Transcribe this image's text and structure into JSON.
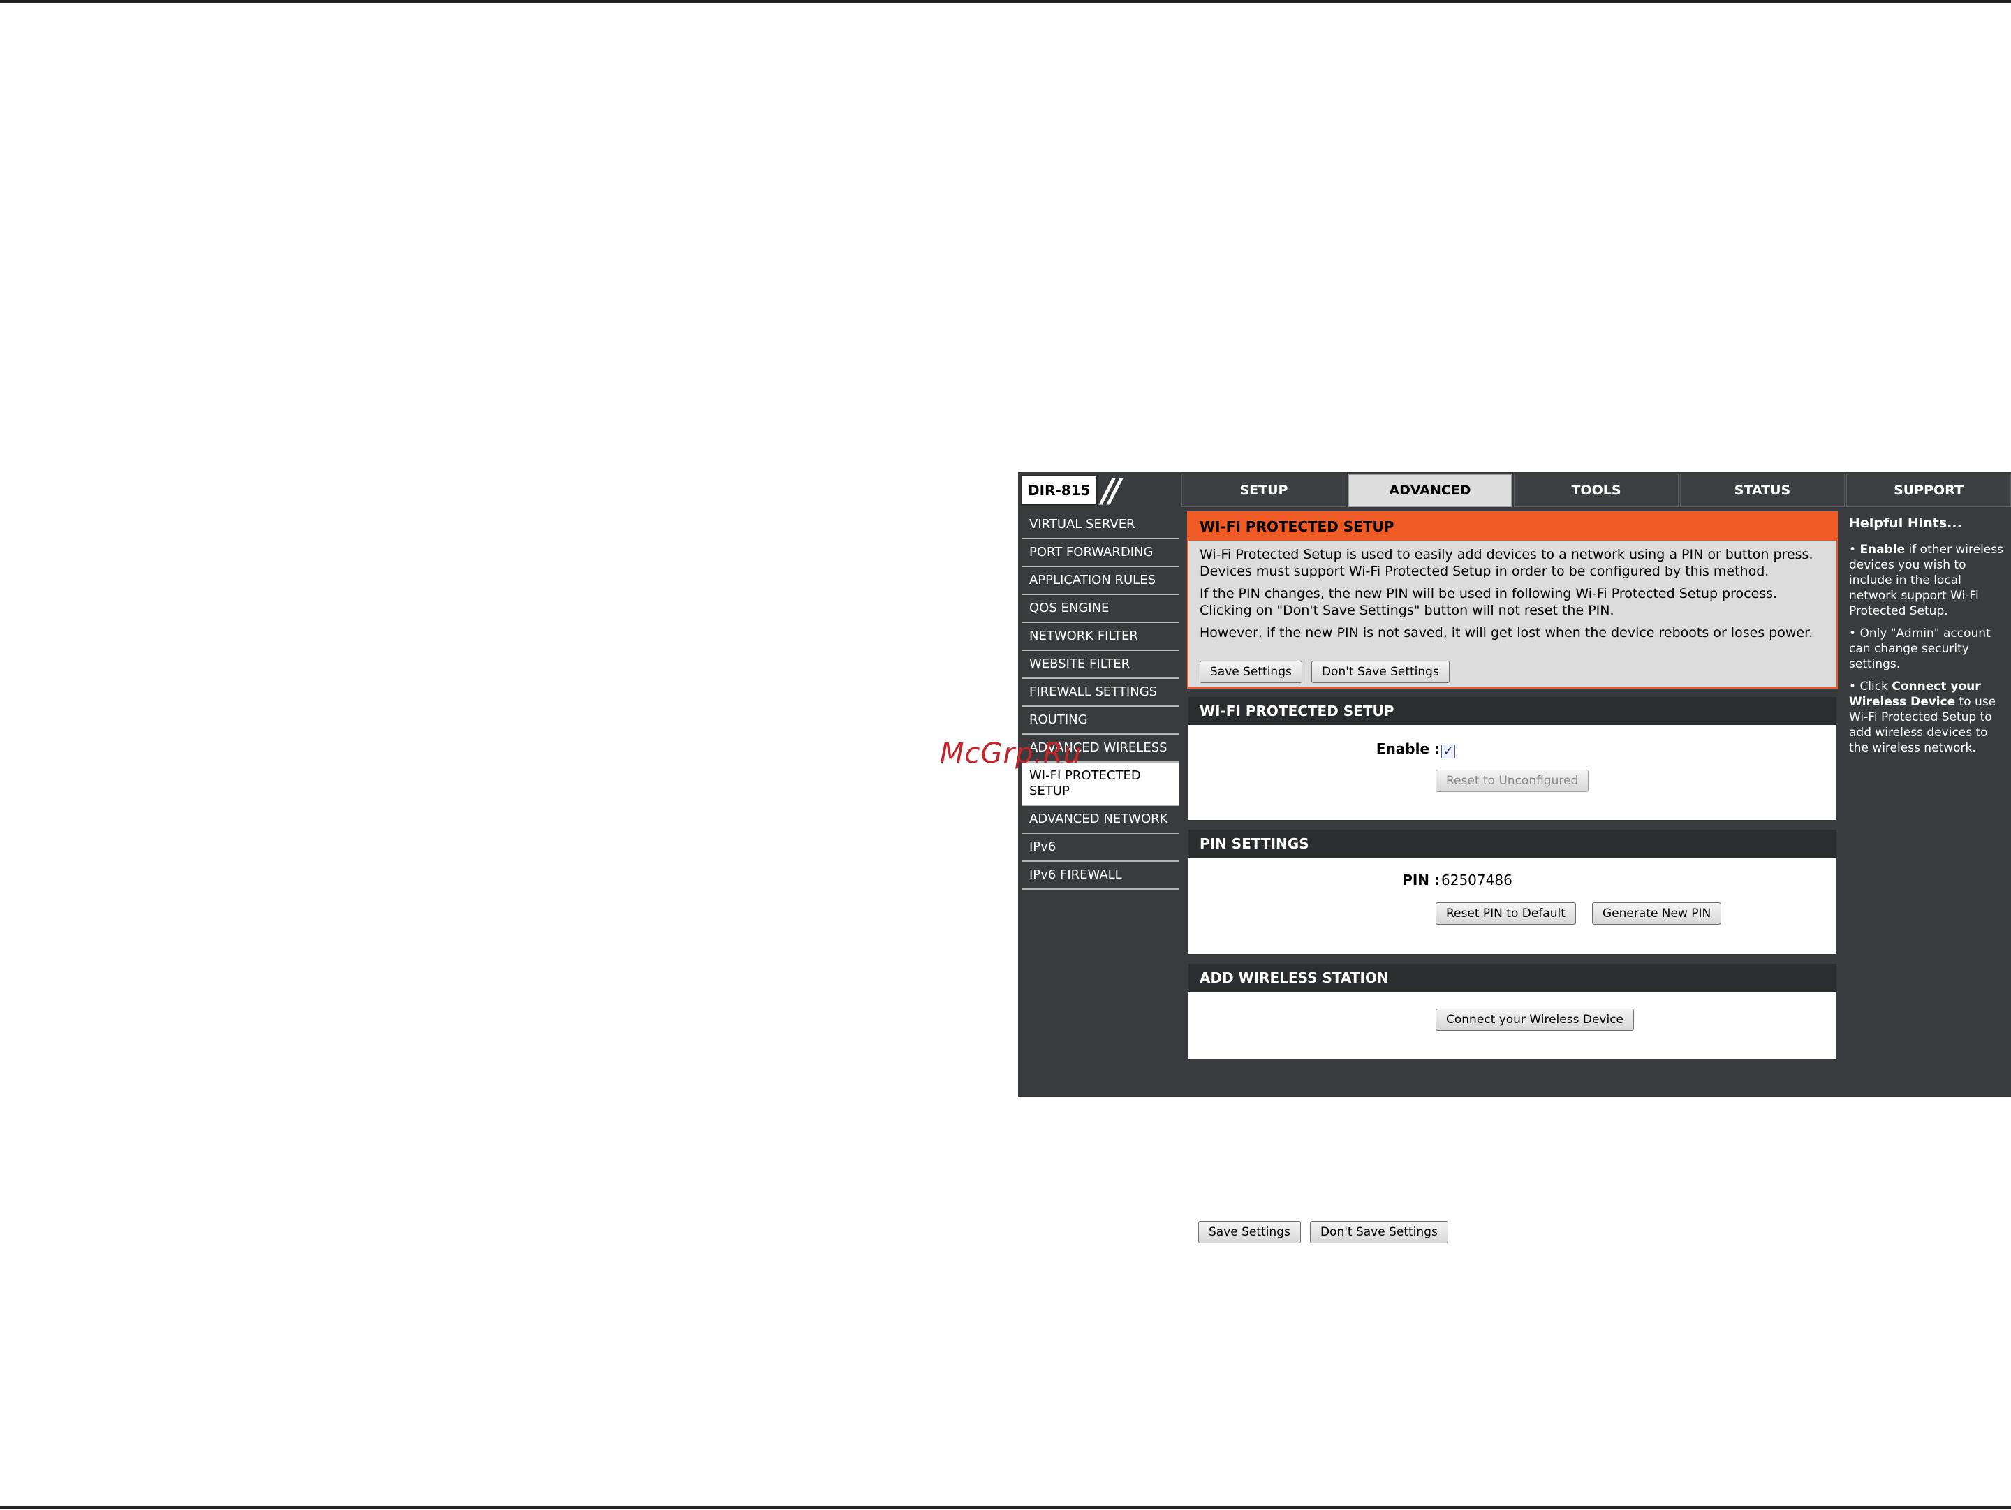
{
  "watermark": "McGrp.Ru",
  "header": {
    "model": "DIR-815",
    "tabs": [
      "SETUP",
      "ADVANCED",
      "TOOLS",
      "STATUS",
      "SUPPORT"
    ],
    "active_tab": "ADVANCED"
  },
  "sidebar": {
    "items": [
      "VIRTUAL SERVER",
      "PORT FORWARDING",
      "APPLICATION RULES",
      "QOS ENGINE",
      "NETWORK FILTER",
      "WEBSITE FILTER",
      "FIREWALL SETTINGS",
      "ROUTING",
      "ADVANCED WIRELESS",
      "WI-FI PROTECTED SETUP",
      "ADVANCED NETWORK",
      "IPv6",
      "IPv6 FIREWALL"
    ],
    "active_item": "WI-FI PROTECTED SETUP"
  },
  "intro": {
    "title": "WI-FI PROTECTED SETUP",
    "para1": "Wi-Fi Protected Setup is used to easily add devices to a network using a PIN or button press. Devices must support Wi-Fi Protected Setup in order to be configured by this method.",
    "para2": "If the PIN changes, the new PIN will be used in following Wi-Fi Protected Setup process. Clicking on \"Don't Save Settings\" button will not reset the PIN.",
    "para3": "However, if the new PIN is not saved, it will get lost when the device reboots or loses power.",
    "save_label": "Save Settings",
    "dont_save_label": "Don't Save Settings"
  },
  "wps": {
    "title": "WI-FI PROTECTED SETUP",
    "enable_label": "Enable :",
    "enable_checked": true,
    "reset_unconfigured_label": "Reset to Unconfigured"
  },
  "pin": {
    "title": "PIN SETTINGS",
    "pin_label": "PIN :",
    "pin_value": "62507486",
    "reset_pin_label": "Reset PIN to Default",
    "generate_pin_label": "Generate New PIN"
  },
  "station": {
    "title": "ADD WIRELESS STATION",
    "connect_label": "Connect your Wireless Device"
  },
  "footer": {
    "save_label": "Save Settings",
    "dont_save_label": "Don't Save Settings"
  },
  "hints": {
    "title": "Helpful Hints...",
    "hint1_bold": "Enable",
    "hint1_text": " if other wireless devices you wish to include in the local network support Wi-Fi Protected Setup.",
    "hint2_text": "Only \"Admin\" account can change security settings.",
    "hint3_pre": "Click ",
    "hint3_bold": "Connect your Wireless Device",
    "hint3_text": " to use Wi-Fi Protected Setup to add wireless devices to the wireless network."
  }
}
